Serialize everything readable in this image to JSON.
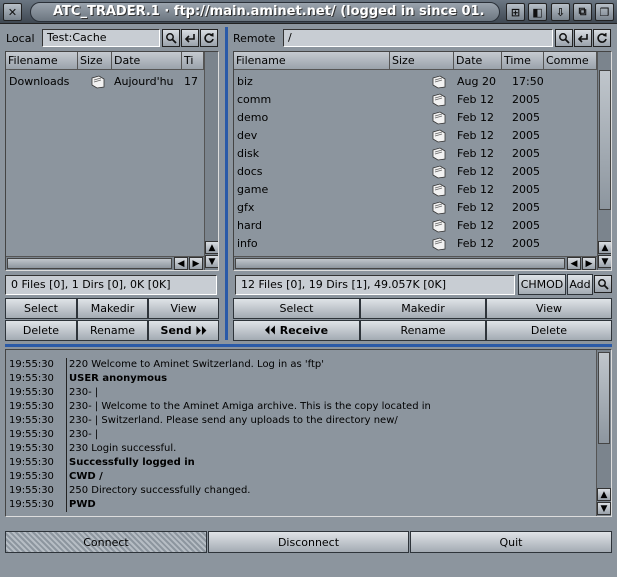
{
  "window": {
    "title": "ATC_TRADER.1 · ftp://main.aminet.net/ (logged in since 01.",
    "close_glyph": "✕",
    "right_buttons": [
      "⊞",
      "◧",
      "⇩",
      "⧉",
      "❐"
    ]
  },
  "local": {
    "label": "Local",
    "path": "Test:Cache",
    "columns": [
      "Filename",
      "Size",
      "Date",
      "Ti"
    ],
    "rows": [
      {
        "name": "Downloads",
        "date": "Aujourd'hu",
        "time": "17"
      }
    ],
    "status": "0 Files [0], 1 Dirs [0], 0K [0K]",
    "buttons_row1": [
      "Select",
      "Makedir",
      "View"
    ],
    "buttons_row2": [
      "Delete",
      "Rename",
      "Send ⏵⏵"
    ]
  },
  "remote": {
    "label": "Remote",
    "path": "/",
    "columns": [
      "Filename",
      "Size",
      "Date",
      "Time",
      "Comme"
    ],
    "rows": [
      {
        "name": "biz",
        "date": "Aug 20",
        "time": "17:50"
      },
      {
        "name": "comm",
        "date": "Feb 12",
        "time": "2005"
      },
      {
        "name": "demo",
        "date": "Feb 12",
        "time": "2005"
      },
      {
        "name": "dev",
        "date": "Feb 12",
        "time": "2005"
      },
      {
        "name": "disk",
        "date": "Feb 12",
        "time": "2005"
      },
      {
        "name": "docs",
        "date": "Feb 12",
        "time": "2005"
      },
      {
        "name": "game",
        "date": "Feb 12",
        "time": "2005"
      },
      {
        "name": "gfx",
        "date": "Feb 12",
        "time": "2005"
      },
      {
        "name": "hard",
        "date": "Feb 12",
        "time": "2005"
      },
      {
        "name": "info",
        "date": "Feb 12",
        "time": "2005"
      }
    ],
    "status": "12 Files [0], 19 Dirs [1], 49.057K [0K]",
    "chmod_label": "CHMOD",
    "add_label": "Add",
    "buttons_row1": [
      "Select",
      "Makedir",
      "View"
    ],
    "buttons_row2": [
      "⏴⏴ Receive",
      "Rename",
      "Delete"
    ]
  },
  "log": [
    {
      "time": "19:55:30",
      "msg": "220 Welcome to Aminet Switzerland. Log in as 'ftp'",
      "bold": false
    },
    {
      "time": "19:55:30",
      "msg": "USER anonymous",
      "bold": true
    },
    {
      "time": "19:55:30",
      "msg": "230- |",
      "bold": false
    },
    {
      "time": "19:55:30",
      "msg": "230- | Welcome to the Aminet Amiga archive. This is the copy located in",
      "bold": false
    },
    {
      "time": "19:55:30",
      "msg": "230- | Switzerland. Please send any uploads to the directory new/",
      "bold": false
    },
    {
      "time": "19:55:30",
      "msg": "230- |",
      "bold": false
    },
    {
      "time": "19:55:30",
      "msg": "230 Login successful.",
      "bold": false
    },
    {
      "time": "19:55:30",
      "msg": "Successfully logged in",
      "bold": true
    },
    {
      "time": "19:55:30",
      "msg": "CWD /",
      "bold": true
    },
    {
      "time": "19:55:30",
      "msg": "250 Directory successfully changed.",
      "bold": false
    },
    {
      "time": "19:55:30",
      "msg": "PWD",
      "bold": true
    }
  ],
  "bottom": {
    "connect": "Connect",
    "disconnect": "Disconnect",
    "quit": "Quit"
  },
  "colors": {
    "accent_divider": "#2a5aa8",
    "panel_bg": "#8c959e"
  }
}
